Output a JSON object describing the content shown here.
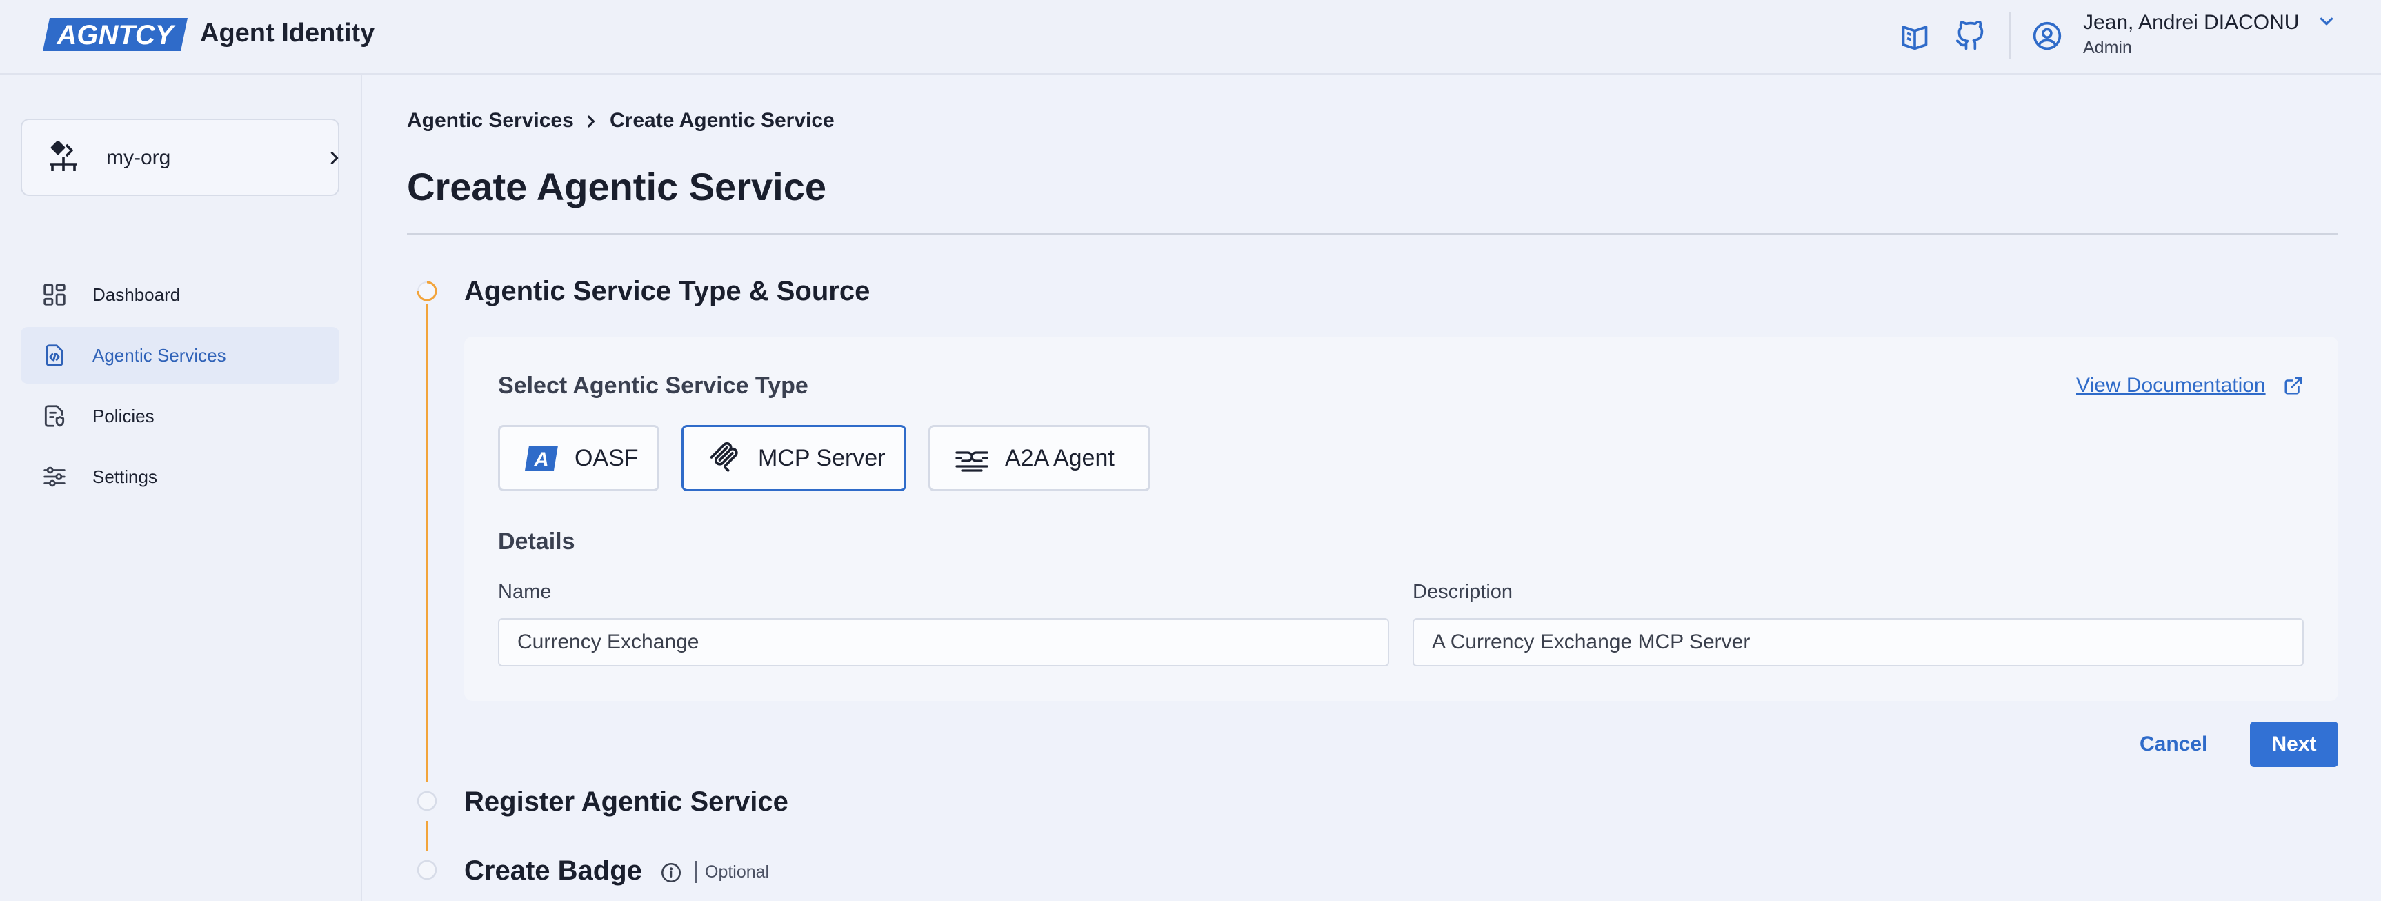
{
  "header": {
    "logo_text": "AGNTCY",
    "app_title": "Agent Identity",
    "docs_icon": "book-icon",
    "github_icon": "github-icon",
    "user": {
      "icon": "user-circle-icon",
      "name": "Jean, Andrei DIACONU",
      "role": "Admin"
    }
  },
  "sidebar": {
    "org": {
      "name": "my-org",
      "icon": "org-structure-icon"
    },
    "items": [
      {
        "label": "Dashboard",
        "icon": "dashboard-grid-icon",
        "active": false
      },
      {
        "label": "Agentic Services",
        "icon": "agentic-services-icon",
        "active": true
      },
      {
        "label": "Policies",
        "icon": "policy-document-icon",
        "active": false
      },
      {
        "label": "Settings",
        "icon": "sliders-icon",
        "active": false
      }
    ]
  },
  "breadcrumb": [
    "Agentic Services",
    "Create Agentic Service"
  ],
  "page_title": "Create Agentic Service",
  "steps": [
    {
      "title": "Agentic Service Type & Source",
      "state": "current"
    },
    {
      "title": "Register Agentic Service",
      "state": "pending"
    },
    {
      "title": "Create Badge",
      "state": "pending",
      "optional_label": "Optional"
    }
  ],
  "type_section": {
    "heading": "Select Agentic Service Type",
    "doc_link": "View Documentation",
    "types": [
      {
        "label": "OASF",
        "icon": "oasf-icon",
        "selected": false
      },
      {
        "label": "MCP Server",
        "icon": "mcp-icon",
        "selected": true
      },
      {
        "label": "A2A Agent",
        "icon": "a2a-icon",
        "selected": false
      }
    ]
  },
  "details": {
    "heading": "Details",
    "name_label": "Name",
    "name_value": "Currency Exchange",
    "description_label": "Description",
    "description_value": "A Currency Exchange MCP Server"
  },
  "actions": {
    "cancel": "Cancel",
    "next": "Next"
  },
  "colors": {
    "accent": "#3271d4",
    "step_progress": "#f2a43a",
    "background": "#eff2fa"
  }
}
